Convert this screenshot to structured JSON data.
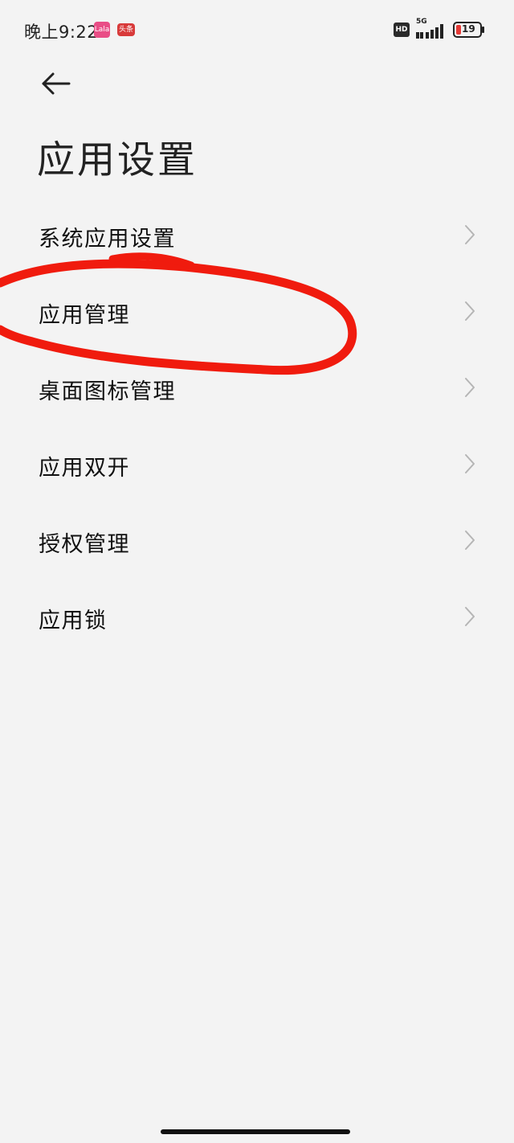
{
  "status_bar": {
    "time": "晚上9:22",
    "app_badge_1": "Lala",
    "app_badge_2": "头条",
    "hd_label": "HD",
    "network": "5G",
    "battery": "19"
  },
  "header": {
    "title": "应用设置"
  },
  "menu": {
    "items": [
      {
        "label": "系统应用设置"
      },
      {
        "label": "应用管理"
      },
      {
        "label": "桌面图标管理"
      },
      {
        "label": "应用双开"
      },
      {
        "label": "授权管理"
      },
      {
        "label": "应用锁"
      }
    ]
  },
  "colors": {
    "background": "#f3f3f3",
    "annotation": "#f01b0e",
    "chevron": "#b5b5b5"
  }
}
